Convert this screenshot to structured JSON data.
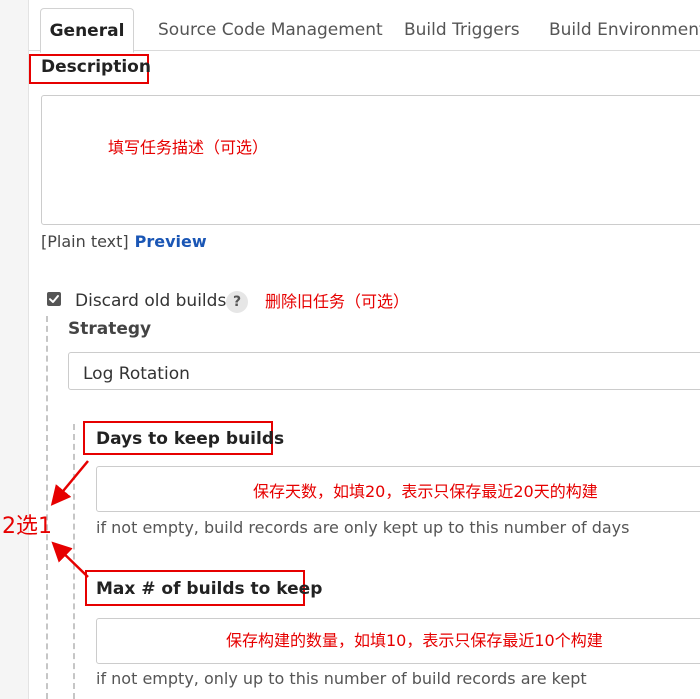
{
  "tabs": [
    {
      "label": "General",
      "active": true
    },
    {
      "label": "Source Code Management",
      "active": false
    },
    {
      "label": "Build Triggers",
      "active": false
    },
    {
      "label": "Build Environment",
      "active": false
    }
  ],
  "description": {
    "label": "Description",
    "annotation": "填写任务描述（可选）",
    "format_text": "[Plain text]",
    "preview_link": "Preview"
  },
  "discard": {
    "label": "Discard old builds",
    "checked": true,
    "help_glyph": "?",
    "annotation": "删除旧任务（可选）",
    "strategy_label": "Strategy",
    "strategy_value": "Log Rotation"
  },
  "days_to_keep": {
    "label": "Days to keep builds",
    "annotation": "保存天数，如填20，表示只保存最近20天的构建",
    "hint": "if not empty, build records are only kept up to this number of days"
  },
  "max_builds": {
    "label": "Max # of builds to keep",
    "annotation": "保存构建的数量，如填10，表示只保存最近10个构建",
    "hint": "if not empty, only up to this number of build records are kept"
  },
  "choose_one_annotation": "2选1",
  "colors": {
    "annotation_red": "#e60000",
    "link_blue": "#1a56b5",
    "border_gray": "#cccccc"
  },
  "icons": {
    "checkbox": "checkbox-checked-icon",
    "help": "question-mark-icon",
    "arrows": "red-arrow-icon"
  }
}
